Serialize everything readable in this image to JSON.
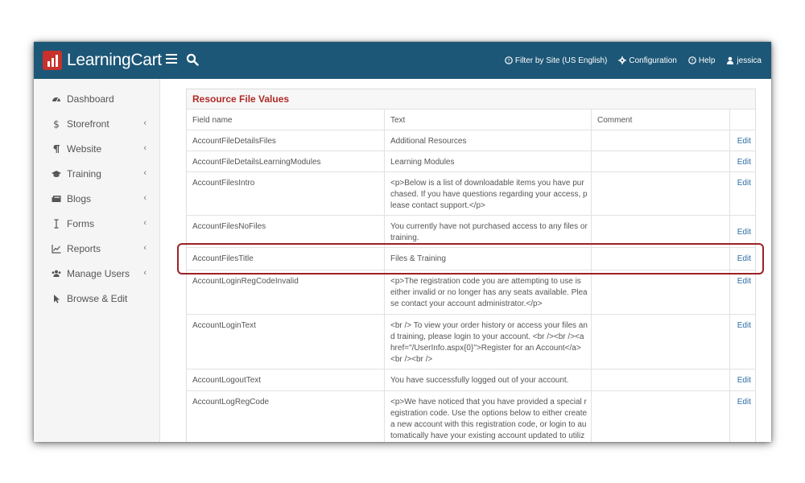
{
  "brand": {
    "name": "LearningCart",
    "accent": "#c8312c",
    "topbar_color": "#1d5777"
  },
  "topnav": {
    "filter_label": "Filter by Site (US English)",
    "configuration_label": "Configuration",
    "help_label": "Help",
    "user_label": "jessica"
  },
  "sidebar": {
    "items": [
      {
        "label": "Dashboard",
        "icon": "dashboard-icon",
        "chevron": ""
      },
      {
        "label": "Storefront",
        "icon": "dollar-icon",
        "chevron": "‹"
      },
      {
        "label": "Website",
        "icon": "paragraph-icon",
        "chevron": "‹"
      },
      {
        "label": "Training",
        "icon": "graduation-cap-icon",
        "chevron": "‹"
      },
      {
        "label": "Blogs",
        "icon": "newspaper-icon",
        "chevron": "‹"
      },
      {
        "label": "Forms",
        "icon": "text-cursor-icon",
        "chevron": "‹"
      },
      {
        "label": "Reports",
        "icon": "line-chart-icon",
        "chevron": "‹"
      },
      {
        "label": "Manage Users",
        "icon": "users-icon",
        "chevron": "‹"
      },
      {
        "label": "Browse & Edit",
        "icon": "pointer-icon",
        "chevron": ""
      }
    ]
  },
  "panel": {
    "title": "Resource File Values",
    "columns": {
      "field": "Field name",
      "text": "Text",
      "comment": "Comment"
    },
    "rows": [
      {
        "field": "AccountFileDetailsFiles",
        "text": "Additional Resources",
        "comment": "",
        "action": "Edit"
      },
      {
        "field": "AccountFileDetailsLearningModules",
        "text": "Learning Modules",
        "comment": "",
        "action": "Edit"
      },
      {
        "field": "AccountFilesIntro",
        "text": "<p>Below is a list of downloadable items you have purchased. If you have questions regarding your access, please contact support.</p>",
        "comment": "",
        "action": "Edit"
      },
      {
        "field": "AccountFilesNoFiles",
        "text": "You currently have not purchased access to any files or training.",
        "comment": "",
        "action": "Edit"
      },
      {
        "field": "AccountFilesTitle",
        "text": "Files & Training",
        "comment": "",
        "action": "Edit"
      },
      {
        "field": "AccountLoginRegCodeInvalid",
        "text": "<p>The registration code you are attempting to use is either invalid or no longer has any seats available. Please contact your account administrator.</p>",
        "comment": "",
        "action": "Edit"
      },
      {
        "field": "AccountLoginText",
        "text": "<br /> To view your order history or access your files and training, please login to your account. <br /><br /><a href=\"/UserInfo.aspx{0}\">Register for an Account</a> <br /><br />",
        "comment": "",
        "action": "Edit"
      },
      {
        "field": "AccountLogoutText",
        "text": "You have successfully logged out of your account.",
        "comment": "",
        "action": "Edit"
      },
      {
        "field": "AccountLogRegCode",
        "text": "<p>We have noticed that you have provided a special registration code. Use the options below to either create a new account with this registration code, or login to automatically have your existing account updated to utilize t",
        "comment": "",
        "action": "Edit"
      }
    ]
  },
  "highlight_color": "#9d2126"
}
